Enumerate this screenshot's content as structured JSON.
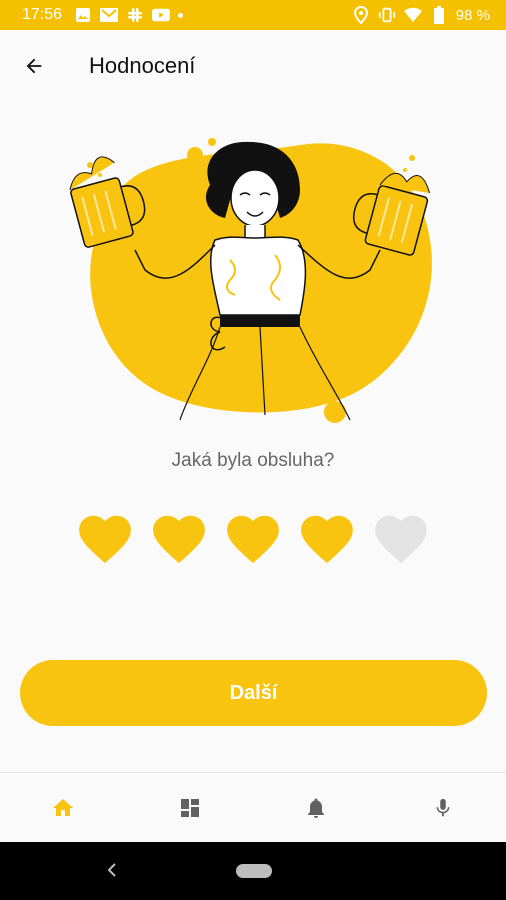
{
  "status_bar": {
    "time": "17:56",
    "battery_percent": "98 %",
    "icons": [
      "photo-icon",
      "gmail-icon",
      "slack-icon",
      "youtube-icon",
      "notification-dot-icon",
      "location-icon",
      "vibrate-icon",
      "wifi-icon",
      "battery-icon"
    ]
  },
  "app_bar": {
    "back_icon": "arrow-left-icon",
    "title": "Hodnocení"
  },
  "illustration": {
    "description_icon": "woman-with-beer-illustration"
  },
  "rating": {
    "question": "Jaká byla obsluha?",
    "max": 5,
    "value": 4,
    "active_color": "#f9c40f",
    "inactive_color": "#e3e3e3"
  },
  "next_button": {
    "label": "Další",
    "color": "#f9c40f"
  },
  "bottom_nav": {
    "items": [
      {
        "icon": "home-icon",
        "active": true
      },
      {
        "icon": "dashboard-icon",
        "active": false
      },
      {
        "icon": "bell-icon",
        "active": false
      },
      {
        "icon": "microphone-icon",
        "active": false
      }
    ],
    "active_color": "#f9c40f",
    "inactive_color": "#616161"
  },
  "colors": {
    "accent": "#f9c40f",
    "status_bar": "#f5c000"
  }
}
